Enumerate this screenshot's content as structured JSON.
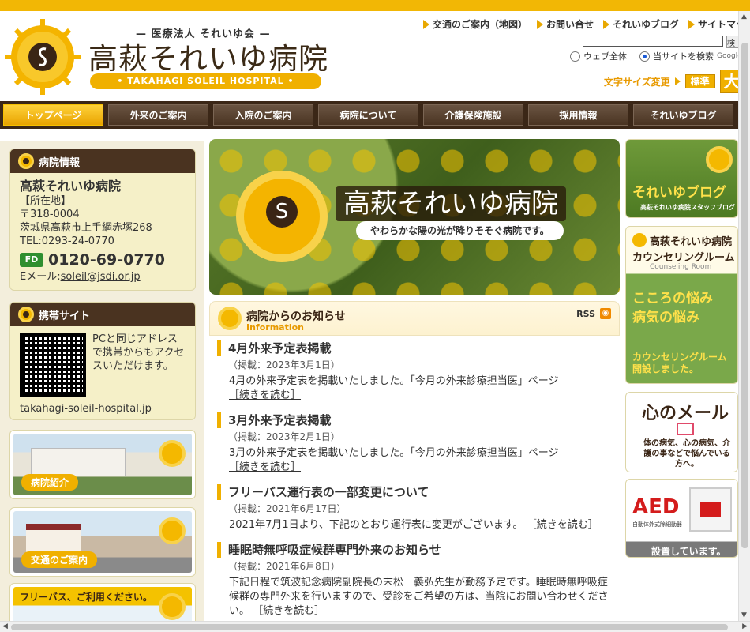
{
  "header": {
    "subtitle": "— 医療法人 それいゆ会 —",
    "title": "高萩それいゆ病院",
    "band": "• TAKAHAGI SOLEIL HOSPITAL •",
    "links": [
      "交通のご案内（地図）",
      "お問い合せ",
      "それいゆブログ",
      "サイトマップ"
    ],
    "search_button": "検索",
    "radio_web": "ウェブ全体",
    "radio_site": "当サイトを検索",
    "google": "Google",
    "fontsize_label": "文字サイズ変更",
    "fontsize_standard": "標準",
    "fontsize_large": "大"
  },
  "nav": [
    "トップページ",
    "外来のご案内",
    "入院のご案内",
    "病院について",
    "介護保険施設",
    "採用情報",
    "それいゆブログ"
  ],
  "left": {
    "info": {
      "head": "病院情報",
      "name": "高萩それいゆ病院",
      "address_label": "【所在地】",
      "zip": "〒318-0004",
      "address": "茨城県高萩市上手綱赤塚268",
      "tel": "TEL:0293-24-0770",
      "freedial_icon": "FD",
      "freedial": "0120-69-0770",
      "email_label": "Eメール:",
      "email": "soleil@jsdi.or.jp"
    },
    "mobile": {
      "head": "携帯サイト",
      "text": "PCと同じアドレスで携帯からもアクセスいただけます。",
      "url": "takahagi-soleil-hospital.jp"
    },
    "banners": [
      {
        "label": "病院紹介"
      },
      {
        "label": "交通のご案内"
      },
      {
        "label": "フリーバス、ご利用ください。"
      }
    ]
  },
  "hero": {
    "title": "高萩それいゆ病院",
    "subtitle": "やわらかな陽の光が降りそそぐ病院です。"
  },
  "news": {
    "title": "病院からのお知らせ",
    "title_en": "Information",
    "rss": "RSS",
    "items": [
      {
        "title": "4月外来予定表掲載",
        "date": "（掲載：2023年3月1日）",
        "body": "4月の外来予定表を掲載いたしました。「今月の外来診療担当医」ページ",
        "more": "［続きを読む］"
      },
      {
        "title": "3月外来予定表掲載",
        "date": "（掲載：2023年2月1日）",
        "body": "3月の外来予定表を掲載いたしました。「今月の外来診療担当医」ページ",
        "more": "［続きを読む］"
      },
      {
        "title": "フリーバス運行表の一部変更について",
        "date": "（掲載：2021年6月17日）",
        "body": "2021年7月1日より、下記のとおり運行表に変更がございます。",
        "more": "［続きを読む］"
      },
      {
        "title": "睡眠時無呼吸症候群専門外来のお知らせ",
        "date": "（掲載：2021年6月8日）",
        "body": "下記日程で筑波記念病院副院長の末松　義弘先生が勤務予定です。睡眠時無呼吸症候群の専門外来を行いますので、受診をご希望の方は、当院にお問い合わせください。",
        "more": "［続きを読む］"
      }
    ]
  },
  "right": {
    "blog": {
      "title": "それいゆブログ",
      "sub": "高萩それいゆ病院スタッフブログ"
    },
    "counseling": {
      "name": "高萩それいゆ病院",
      "title": "カウンセリングルーム",
      "en": "Counseling Room",
      "line1": "こころの悩み",
      "line2": "病気の悩み",
      "footer": "カウンセリングルーム開設しました。"
    },
    "mail": {
      "title": "心のメール",
      "text": "体の病気、心の病気、介護の事などで悩んでいる方へ。"
    },
    "aed": {
      "title": "AED",
      "sub": "自動体外式除細動器",
      "footer": "設置しています。"
    }
  }
}
